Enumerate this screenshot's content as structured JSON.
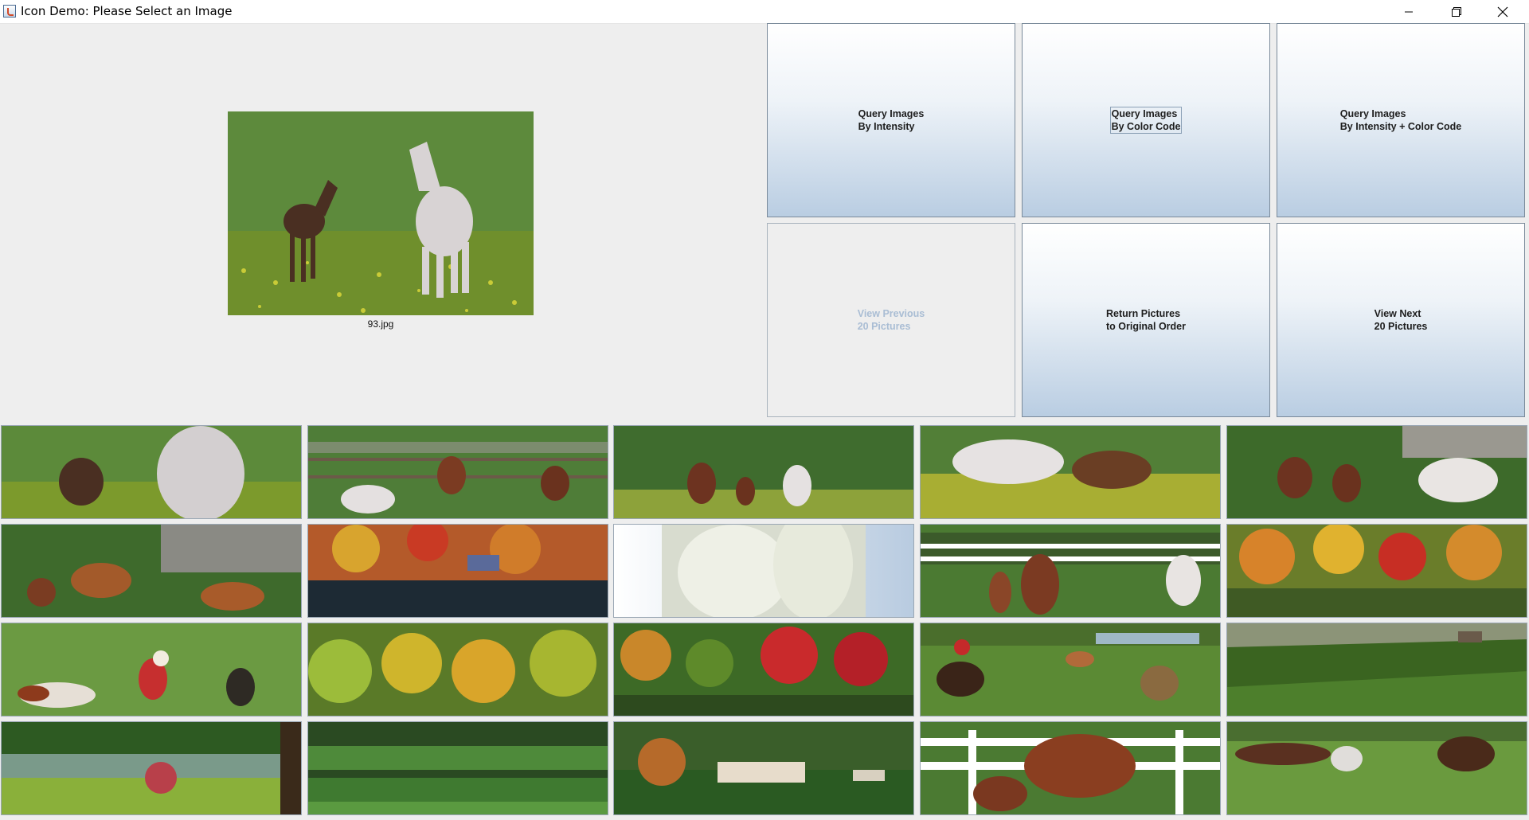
{
  "window": {
    "title": "Icon Demo: Please Select an Image"
  },
  "preview": {
    "caption": "93.jpg"
  },
  "buttons": {
    "query_intensity": {
      "line1": "Query Images",
      "line2": "By Intensity"
    },
    "query_color_code": {
      "line1": "Query Images",
      "line2": "By Color Code"
    },
    "query_intensity_color": {
      "line1": "Query Images",
      "line2": "By Intensity + Color Code"
    },
    "view_previous": {
      "line1": "View Previous",
      "line2": "20 Pictures"
    },
    "return_original": {
      "line1": "Return Pictures",
      "line2": "to Original Order"
    },
    "view_next": {
      "line1": "View Next",
      "line2": "20 Pictures"
    }
  },
  "colors": {
    "button_gradient_bottom": "#b9cde2",
    "disabled_text": "#a9bdd4",
    "background": "#eeeeee"
  },
  "icons": [
    "java-app-icon",
    "minimize-icon",
    "restore-icon",
    "close-icon"
  ]
}
